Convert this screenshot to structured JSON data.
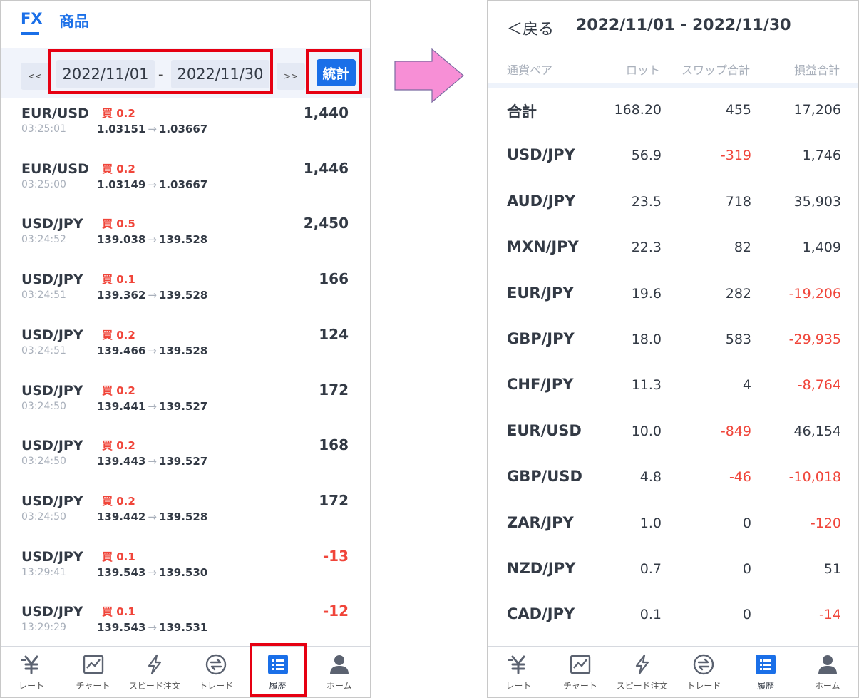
{
  "left": {
    "tabs": {
      "fx": "FX",
      "commodity": "商品"
    },
    "date_bar": {
      "prev": "<<",
      "start": "2022/11/01",
      "sep": "-",
      "end": "2022/11/30",
      "next": ">>",
      "stats_button": "統計"
    },
    "trades": [
      {
        "pair": "EUR/USD",
        "time": "03:25:01",
        "side": "買 0.2",
        "open": "1.03151",
        "close": "1.03667",
        "pl": "1,440",
        "neg": false
      },
      {
        "pair": "EUR/USD",
        "time": "03:25:00",
        "side": "買 0.2",
        "open": "1.03149",
        "close": "1.03667",
        "pl": "1,446",
        "neg": false
      },
      {
        "pair": "USD/JPY",
        "time": "03:24:52",
        "side": "買 0.5",
        "open": "139.038",
        "close": "139.528",
        "pl": "2,450",
        "neg": false
      },
      {
        "pair": "USD/JPY",
        "time": "03:24:51",
        "side": "買 0.1",
        "open": "139.362",
        "close": "139.528",
        "pl": "166",
        "neg": false
      },
      {
        "pair": "USD/JPY",
        "time": "03:24:51",
        "side": "買 0.2",
        "open": "139.466",
        "close": "139.528",
        "pl": "124",
        "neg": false
      },
      {
        "pair": "USD/JPY",
        "time": "03:24:50",
        "side": "買 0.2",
        "open": "139.441",
        "close": "139.527",
        "pl": "172",
        "neg": false
      },
      {
        "pair": "USD/JPY",
        "time": "03:24:50",
        "side": "買 0.2",
        "open": "139.443",
        "close": "139.527",
        "pl": "168",
        "neg": false
      },
      {
        "pair": "USD/JPY",
        "time": "03:24:50",
        "side": "買 0.2",
        "open": "139.442",
        "close": "139.528",
        "pl": "172",
        "neg": false
      },
      {
        "pair": "USD/JPY",
        "time": "13:29:41",
        "side": "買 0.1",
        "open": "139.543",
        "close": "139.530",
        "pl": "-13",
        "neg": true
      },
      {
        "pair": "USD/JPY",
        "time": "13:29:29",
        "side": "買 0.1",
        "open": "139.543",
        "close": "139.531",
        "pl": "-12",
        "neg": true
      }
    ]
  },
  "right": {
    "back": "＜戻る",
    "range": "2022/11/01 - 2022/11/30",
    "headers": {
      "pair": "通貨ペア",
      "lot": "ロット",
      "swap": "スワップ合計",
      "pl": "損益合計"
    },
    "rows": [
      {
        "pair": "合計",
        "lot": "168.20",
        "swap": "455",
        "pl": "17,206",
        "swap_neg": false,
        "pl_neg": false
      },
      {
        "pair": "USD/JPY",
        "lot": "56.9",
        "swap": "-319",
        "pl": "1,746",
        "swap_neg": true,
        "pl_neg": false
      },
      {
        "pair": "AUD/JPY",
        "lot": "23.5",
        "swap": "718",
        "pl": "35,903",
        "swap_neg": false,
        "pl_neg": false
      },
      {
        "pair": "MXN/JPY",
        "lot": "22.3",
        "swap": "82",
        "pl": "1,409",
        "swap_neg": false,
        "pl_neg": false
      },
      {
        "pair": "EUR/JPY",
        "lot": "19.6",
        "swap": "282",
        "pl": "-19,206",
        "swap_neg": false,
        "pl_neg": true
      },
      {
        "pair": "GBP/JPY",
        "lot": "18.0",
        "swap": "583",
        "pl": "-29,935",
        "swap_neg": false,
        "pl_neg": true
      },
      {
        "pair": "CHF/JPY",
        "lot": "11.3",
        "swap": "4",
        "pl": "-8,764",
        "swap_neg": false,
        "pl_neg": true
      },
      {
        "pair": "EUR/USD",
        "lot": "10.0",
        "swap": "-849",
        "pl": "46,154",
        "swap_neg": true,
        "pl_neg": false
      },
      {
        "pair": "GBP/USD",
        "lot": "4.8",
        "swap": "-46",
        "pl": "-10,018",
        "swap_neg": true,
        "pl_neg": true
      },
      {
        "pair": "ZAR/JPY",
        "lot": "1.0",
        "swap": "0",
        "pl": "-120",
        "swap_neg": false,
        "pl_neg": true
      },
      {
        "pair": "NZD/JPY",
        "lot": "0.7",
        "swap": "0",
        "pl": "51",
        "swap_neg": false,
        "pl_neg": false
      },
      {
        "pair": "CAD/JPY",
        "lot": "0.1",
        "swap": "0",
        "pl": "-14",
        "swap_neg": false,
        "pl_neg": true
      }
    ]
  },
  "tabbar": [
    {
      "label": "レート",
      "icon": "yen-icon"
    },
    {
      "label": "チャート",
      "icon": "chart-icon"
    },
    {
      "label": "スピード注文",
      "icon": "lightning-icon"
    },
    {
      "label": "トレード",
      "icon": "exchange-icon"
    },
    {
      "label": "履歴",
      "icon": "history-list-icon",
      "active": true
    },
    {
      "label": "ホーム",
      "icon": "person-icon"
    }
  ],
  "colors": {
    "accent": "#1a6fe8",
    "negative": "#f0453a",
    "highlight_frame": "#e60012",
    "arrow": "#f78fd6"
  }
}
